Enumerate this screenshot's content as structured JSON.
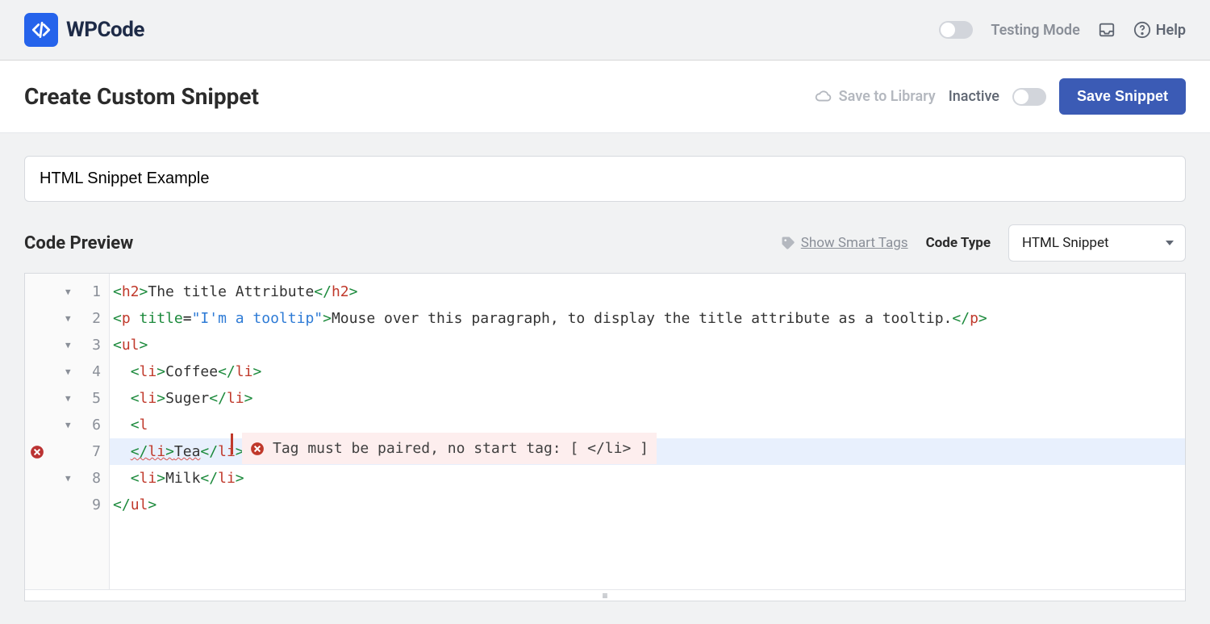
{
  "brand": {
    "name": "WPCode"
  },
  "topbar": {
    "testing_mode_label": "Testing Mode",
    "help_label": "Help"
  },
  "header": {
    "page_title": "Create Custom Snippet",
    "save_library_label": "Save to Library",
    "status_label": "Inactive",
    "save_button_label": "Save Snippet"
  },
  "snippet": {
    "title_value": "HTML Snippet Example"
  },
  "preview": {
    "section_title": "Code Preview",
    "smart_tags_label": "Show Smart Tags",
    "code_type_label": "Code Type",
    "code_type_value": "HTML Snippet"
  },
  "editor": {
    "error_message": "Tag must be paired, no start tag: [ </li> ]",
    "lines": {
      "l1": {
        "num": "1",
        "a": "<",
        "b": "h2",
        "c": ">",
        "t": "The title Attribute",
        "d": "</",
        "e": "h2",
        "f": ">"
      },
      "l2": {
        "num": "2",
        "a": "<",
        "b": "p",
        "sp": " ",
        "attr": "title",
        "eq": "=",
        "str": "\"I'm a tooltip\"",
        "c": ">",
        "t": "Mouse over this paragraph, to display the title attribute as a tooltip.",
        "d": "</",
        "e": "p",
        "f": ">"
      },
      "l3": {
        "num": "3",
        "a": "<",
        "b": "ul",
        "c": ">"
      },
      "l4": {
        "num": "4",
        "indent": "  ",
        "a": "<",
        "b": "li",
        "c": ">",
        "t": "Coffee",
        "d": "</",
        "e": "li",
        "f": ">"
      },
      "l5": {
        "num": "5",
        "indent": "  ",
        "a": "<",
        "b": "li",
        "c": ">",
        "t": "Suger",
        "d": "</",
        "e": "li",
        "f": ">"
      },
      "l6": {
        "num": "6",
        "indent": "  ",
        "a": "<",
        "b": "l"
      },
      "l7": {
        "num": "7",
        "indent": "  ",
        "a": "</",
        "b": "li",
        "c": ">",
        "t": "Tea",
        "d": "</",
        "e": "li",
        "f": ">"
      },
      "l8": {
        "num": "8",
        "indent": "  ",
        "a": "<",
        "b": "li",
        "c": ">",
        "t": "Milk",
        "d": "</",
        "e": "li",
        "f": ">"
      },
      "l9": {
        "num": "9",
        "a": "</",
        "b": "ul",
        "c": ">"
      }
    }
  }
}
